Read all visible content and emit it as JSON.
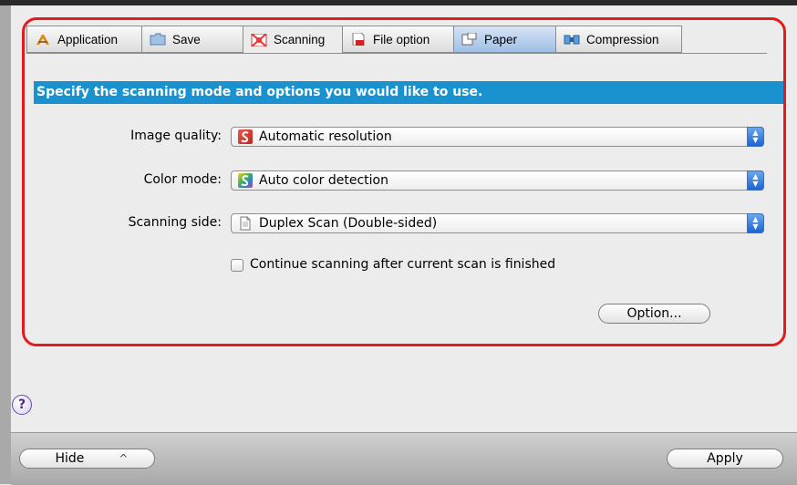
{
  "tabs": [
    {
      "label": "Application",
      "icon": "application-icon"
    },
    {
      "label": "Save",
      "icon": "folder-icon"
    },
    {
      "label": "Scanning",
      "icon": "scanning-icon"
    },
    {
      "label": "File option",
      "icon": "file-option-icon"
    },
    {
      "label": "Paper",
      "icon": "paper-icon"
    },
    {
      "label": "Compression",
      "icon": "compression-icon"
    }
  ],
  "active_tab": "Scanning",
  "header": "Specify the scanning mode and options you would like to use.",
  "fields": {
    "image_quality": {
      "label": "Image quality:",
      "value": "Automatic resolution",
      "icon": "image-quality-icon"
    },
    "color_mode": {
      "label": "Color mode:",
      "value": "Auto color detection",
      "icon": "color-mode-icon"
    },
    "scanning_side": {
      "label": "Scanning side:",
      "value": "Duplex Scan (Double-sided)",
      "icon": "duplex-page-icon"
    }
  },
  "continue_scanning": {
    "label": "Continue scanning after current scan is finished",
    "checked": false
  },
  "option_button": "Option...",
  "help_glyph": "?",
  "footer": {
    "hide_label": "Hide",
    "hide_glyph": "^",
    "apply_label": "Apply"
  },
  "colors": {
    "header_band": "#1a92d0",
    "highlight_border": "#e21c1c",
    "popup_arrow": "#1b64d4"
  }
}
